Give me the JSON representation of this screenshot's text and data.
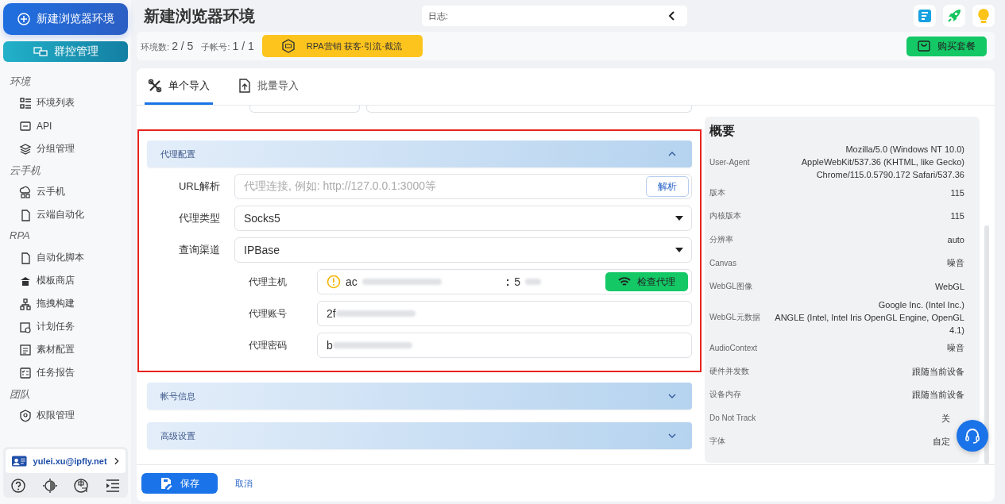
{
  "sidebar": {
    "new_button": "新建浏览器环境",
    "group_button": "群控管理",
    "sections": [
      {
        "title": "环境",
        "items": [
          {
            "label": "环境列表"
          },
          {
            "label": "API"
          },
          {
            "label": "分组管理"
          }
        ]
      },
      {
        "title": "云手机",
        "items": [
          {
            "label": "云手机"
          },
          {
            "label": "云端自动化"
          }
        ]
      },
      {
        "title": "RPA",
        "items": [
          {
            "label": "自动化脚本"
          },
          {
            "label": "模板商店"
          },
          {
            "label": "拖拽构建"
          },
          {
            "label": "计划任务"
          },
          {
            "label": "素材配置"
          },
          {
            "label": "任务报告"
          }
        ]
      },
      {
        "title": "团队",
        "items": [
          {
            "label": "权限管理"
          }
        ]
      }
    ],
    "user": "yulei.xu@ipfly.net"
  },
  "header": {
    "title": "新建浏览器环境",
    "log_label": "日志:"
  },
  "stats": [
    {
      "label": "环境数:",
      "value": "2 / 5"
    },
    {
      "label": "子帐号:",
      "value": "1 / 1"
    }
  ],
  "promo": "RPA营销 获客·引流·截流",
  "buy_button": "购买套餐",
  "tabs": [
    {
      "label": "单个导入",
      "selected": true
    },
    {
      "label": "批量导入",
      "selected": false
    }
  ],
  "form": {
    "sections": [
      {
        "title": "代理配置",
        "expanded": true,
        "rows": [
          {
            "kind": "input",
            "label": "URL解析",
            "placeholder": "代理连接, 例如: http://127.0.0.1:3000等",
            "button": "解析"
          },
          {
            "kind": "select",
            "label": "代理类型",
            "value": "Socks5"
          },
          {
            "kind": "select",
            "label": "查询渠道",
            "value": "IPBase"
          },
          {
            "kind": "host",
            "label": "代理主机",
            "value": "ac",
            "separator": ":",
            "port": "5",
            "button": "检查代理"
          },
          {
            "kind": "text",
            "label": "代理账号",
            "value": "2f"
          },
          {
            "kind": "text",
            "label": "代理密码",
            "value": "b"
          }
        ]
      },
      {
        "title": "帐号信息",
        "expanded": false
      },
      {
        "title": "高级设置",
        "expanded": false
      }
    ]
  },
  "summary": {
    "title": "概要",
    "rows": [
      {
        "label": "User-Agent",
        "value": "Mozilla/5.0 (Windows NT 10.0)\nAppleWebKit/537.36 (KHTML, like Gecko)\nChrome/115.0.5790.172 Safari/537.36"
      },
      {
        "label": "版本",
        "value": "115"
      },
      {
        "label": "内核版本",
        "value": "115"
      },
      {
        "label": "分辨率",
        "value": "auto"
      },
      {
        "label": "Canvas",
        "value": "噪音"
      },
      {
        "label": "WebGL图像",
        "value": "WebGL"
      },
      {
        "label": "WebGL元数据",
        "value": "Google Inc. (Intel Inc.)\nANGLE (Intel, Intel Iris OpenGL Engine, OpenGL\n4.1)"
      },
      {
        "label": "AudioContext",
        "value": "噪音"
      },
      {
        "label": "硬件并发数",
        "value": "跟随当前设备"
      },
      {
        "label": "设备内存",
        "value": "跟随当前设备"
      },
      {
        "label": "Do Not Track",
        "value": "关"
      },
      {
        "label": "字体",
        "value": "自定"
      }
    ]
  },
  "footer": {
    "save": "保存",
    "cancel": "取消"
  }
}
